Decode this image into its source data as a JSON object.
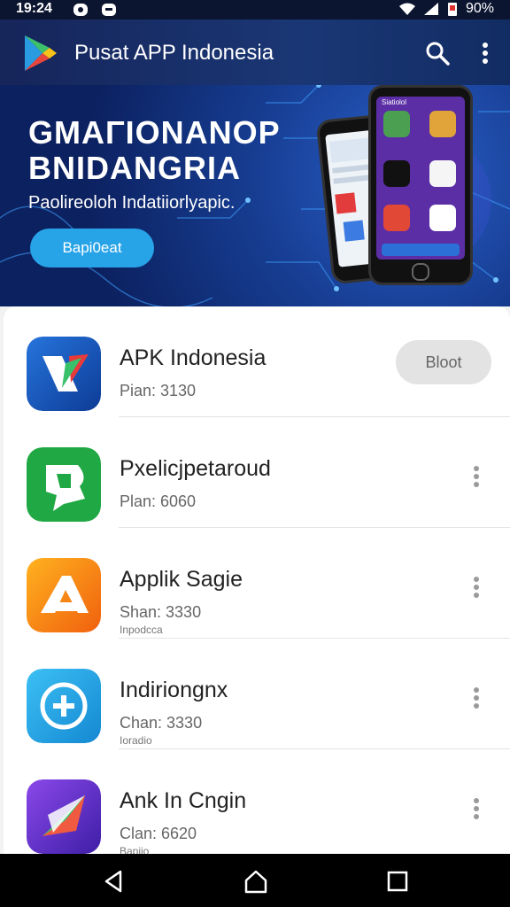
{
  "status": {
    "time": "19:24",
    "battery": "90%"
  },
  "appbar": {
    "title": "Pusat APP Indonesia"
  },
  "banner": {
    "headline1": "GMAΓIONANOP",
    "headline2": "BNIDANGRIA",
    "subtitle": "Paolireoloh Indatiiorlyapic.",
    "cta": "Bapi0eat",
    "phone_header": "Siatiolol"
  },
  "apps": [
    {
      "name": "APK Indonesia",
      "meta": "Pian: 3130",
      "extra": "",
      "action": "Bloot",
      "icon": "apk-indonesia-icon",
      "colors": [
        "#1d5dc6",
        "#0f3f9a"
      ]
    },
    {
      "name": "Pxelicjpetaroud",
      "meta": "Plan: 6060",
      "extra": "",
      "action": "",
      "icon": "pxelicjpetaroud-icon",
      "colors": [
        "#24b64a",
        "#14903a"
      ]
    },
    {
      "name": "Applik Sagie",
      "meta": "Shan: 3330",
      "extra": "Inpodcca",
      "action": "",
      "icon": "applik-sagie-icon",
      "colors": [
        "#ffa31a",
        "#f06a10"
      ]
    },
    {
      "name": "Indiriongnx",
      "meta": "Chan: 3330",
      "extra": "Ioradio",
      "action": "",
      "icon": "indiriongnx-icon",
      "colors": [
        "#35b6f0",
        "#168ed6"
      ]
    },
    {
      "name": "Ank In Cngin",
      "meta": "Clan: 6620",
      "extra": "Bapiio",
      "action": "",
      "icon": "ank-in-cngin-icon",
      "colors": [
        "#7b3fe0",
        "#4b24b4"
      ]
    }
  ]
}
